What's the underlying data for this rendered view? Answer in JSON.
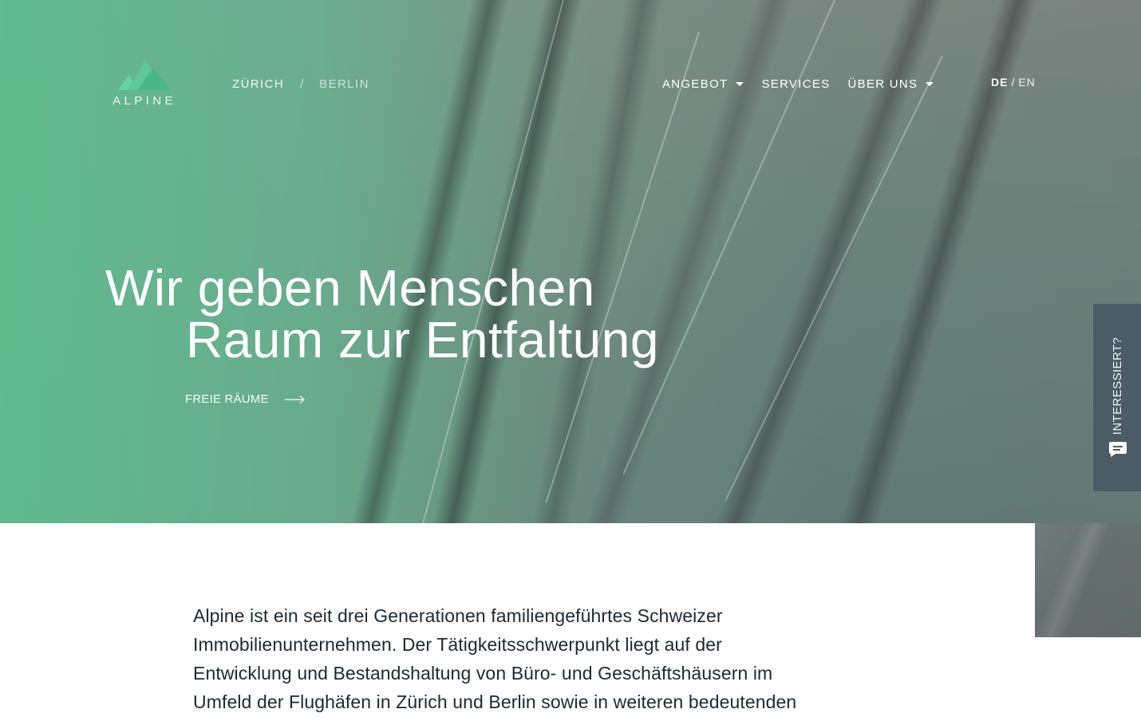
{
  "brand": {
    "logo_text": "ALPINE"
  },
  "cities": {
    "items": [
      {
        "label": "ZÜRICH"
      },
      {
        "label": "BERLIN"
      }
    ],
    "separator": "/"
  },
  "main_nav": {
    "items": [
      {
        "label": "ANGEBOT"
      },
      {
        "label": "SERVICES"
      },
      {
        "label": "ÜBER UNS"
      }
    ]
  },
  "language": {
    "active": "DE",
    "separator": "/",
    "inactive": "EN"
  },
  "hero": {
    "headline_line_1": "Wir geben Menschen",
    "headline_line_2": "Raum zur Entfaltung",
    "cta_label": "FREIE RÄUME"
  },
  "side_panel": {
    "label": "INTERESSIERT?"
  },
  "intro": {
    "lines": [
      "Alpine ist ein seit drei Generationen familiengeführtes Schweizer",
      "Immobilienunternehmen. Der Tätigkeitsschwerpunkt liegt auf der",
      "Entwicklung und Bestandshaltung von Büro- und Geschäftshäusern im",
      "Umfeld der Flughäfen in Zürich und Berlin sowie in weiteren bedeutenden"
    ]
  },
  "colors": {
    "logo_mint": "#65d0a1",
    "side_panel_bg": "#4b5c67",
    "body_text": "#1e2830"
  },
  "icons": {
    "logo": "mountain-logo-icon",
    "dropdown": "chevron-down-icon",
    "cta": "arrow-right-icon",
    "chat": "chat-icon"
  }
}
